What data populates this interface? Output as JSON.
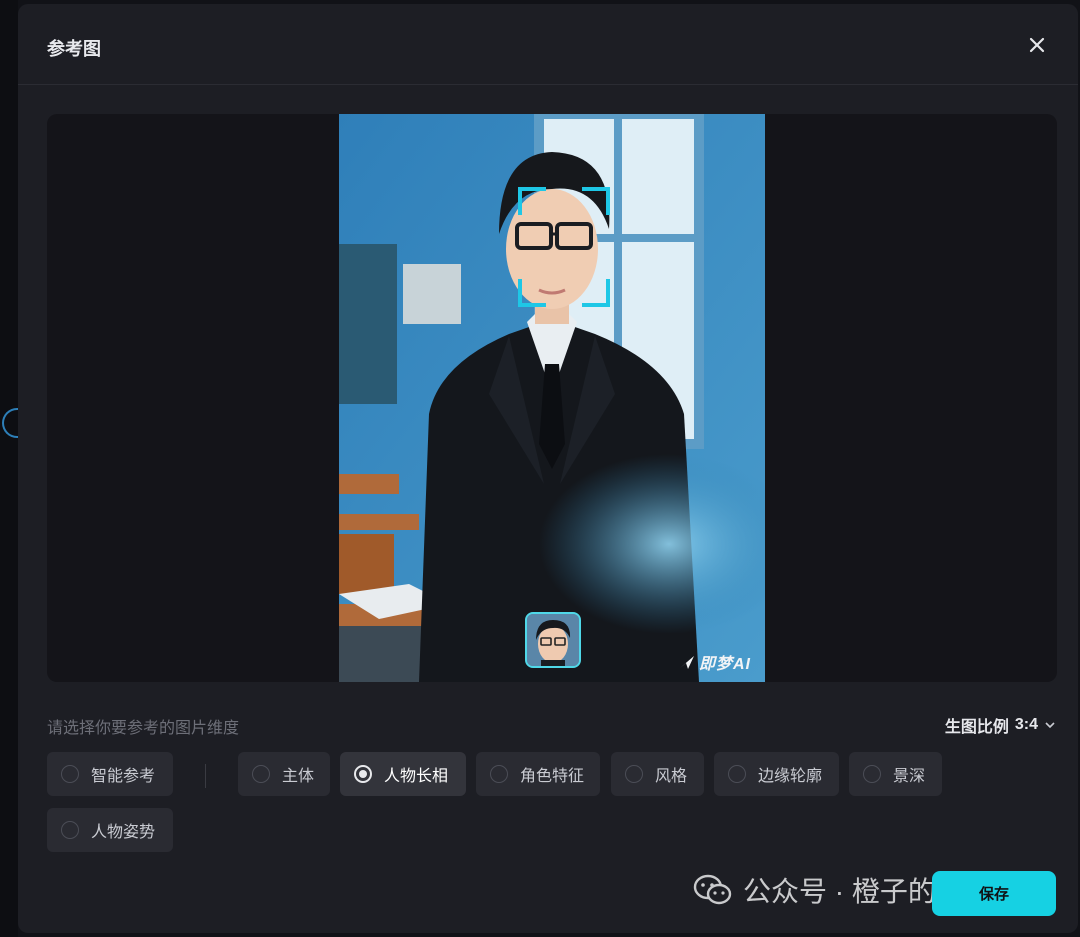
{
  "dialog": {
    "title": "参考图",
    "close_icon": "close-icon"
  },
  "preview": {
    "watermark_text": "即梦AI"
  },
  "hint": "请选择你要参考的图片维度",
  "ratio": {
    "label": "生图比例",
    "value": "3:4"
  },
  "options": [
    {
      "label": "智能参考",
      "selected": false
    },
    {
      "label": "主体",
      "selected": false
    },
    {
      "label": "人物长相",
      "selected": true
    },
    {
      "label": "角色特征",
      "selected": false
    },
    {
      "label": "风格",
      "selected": false
    },
    {
      "label": "边缘轮廓",
      "selected": false
    },
    {
      "label": "景深",
      "selected": false
    },
    {
      "label": "人物姿势",
      "selected": false
    }
  ],
  "footer": {
    "wechat_watermark": "公众号 · 橙子的AI世界",
    "confirm_label": "保存"
  },
  "colors": {
    "accent": "#16d1e3",
    "dialog_bg": "#1d1e24",
    "option_bg": "#2a2b32"
  }
}
